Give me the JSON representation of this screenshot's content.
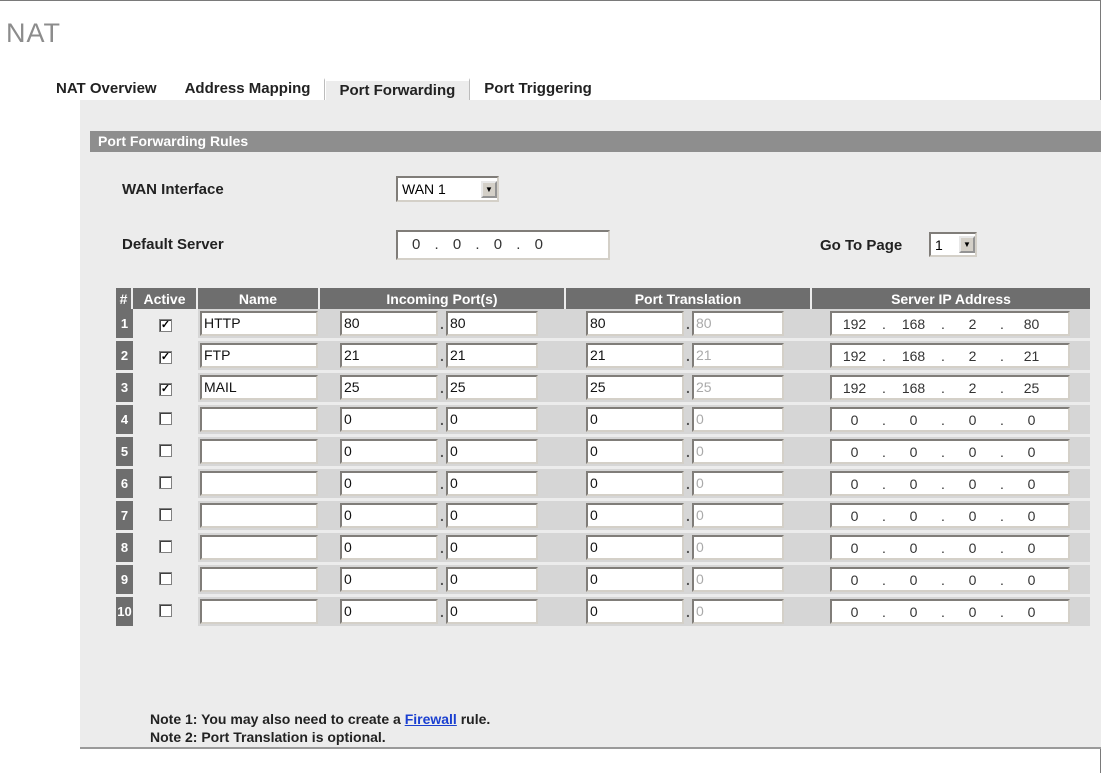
{
  "page_title": "NAT",
  "tabs": [
    {
      "label": "NAT Overview",
      "active": false
    },
    {
      "label": "Address Mapping",
      "active": false
    },
    {
      "label": "Port Forwarding",
      "active": true
    },
    {
      "label": "Port Triggering",
      "active": false
    }
  ],
  "section_title": "Port Forwarding Rules",
  "wan_interface": {
    "label": "WAN Interface",
    "value": "WAN 1"
  },
  "default_server": {
    "label": "Default Server",
    "octets": [
      "0",
      "0",
      "0",
      "0"
    ]
  },
  "go_to_page": {
    "label": "Go To Page",
    "value": "1"
  },
  "columns": [
    "#",
    "Active",
    "Name",
    "Incoming Port(s)",
    "Port Translation",
    "Server IP Address"
  ],
  "rows": [
    {
      "num": "1",
      "active": true,
      "name": "HTTP",
      "in_start": "80",
      "in_end": "80",
      "tr_start": "80",
      "tr_end": "80",
      "ip": [
        "192",
        "168",
        "2",
        "80"
      ]
    },
    {
      "num": "2",
      "active": true,
      "name": "FTP",
      "in_start": "21",
      "in_end": "21",
      "tr_start": "21",
      "tr_end": "21",
      "ip": [
        "192",
        "168",
        "2",
        "21"
      ]
    },
    {
      "num": "3",
      "active": true,
      "name": "MAIL",
      "in_start": "25",
      "in_end": "25",
      "tr_start": "25",
      "tr_end": "25",
      "ip": [
        "192",
        "168",
        "2",
        "25"
      ]
    },
    {
      "num": "4",
      "active": false,
      "name": "",
      "in_start": "0",
      "in_end": "0",
      "tr_start": "0",
      "tr_end": "0",
      "ip": [
        "0",
        "0",
        "0",
        "0"
      ]
    },
    {
      "num": "5",
      "active": false,
      "name": "",
      "in_start": "0",
      "in_end": "0",
      "tr_start": "0",
      "tr_end": "0",
      "ip": [
        "0",
        "0",
        "0",
        "0"
      ]
    },
    {
      "num": "6",
      "active": false,
      "name": "",
      "in_start": "0",
      "in_end": "0",
      "tr_start": "0",
      "tr_end": "0",
      "ip": [
        "0",
        "0",
        "0",
        "0"
      ]
    },
    {
      "num": "7",
      "active": false,
      "name": "",
      "in_start": "0",
      "in_end": "0",
      "tr_start": "0",
      "tr_end": "0",
      "ip": [
        "0",
        "0",
        "0",
        "0"
      ]
    },
    {
      "num": "8",
      "active": false,
      "name": "",
      "in_start": "0",
      "in_end": "0",
      "tr_start": "0",
      "tr_end": "0",
      "ip": [
        "0",
        "0",
        "0",
        "0"
      ]
    },
    {
      "num": "9",
      "active": false,
      "name": "",
      "in_start": "0",
      "in_end": "0",
      "tr_start": "0",
      "tr_end": "0",
      "ip": [
        "0",
        "0",
        "0",
        "0"
      ]
    },
    {
      "num": "10",
      "active": false,
      "name": "",
      "in_start": "0",
      "in_end": "0",
      "tr_start": "0",
      "tr_end": "0",
      "ip": [
        "0",
        "0",
        "0",
        "0"
      ]
    }
  ],
  "notes": {
    "note1_prefix": "Note 1: You may also need to create a ",
    "note1_link": "Firewall",
    "note1_suffix": " rule.",
    "note2": "Note 2: Port Translation is optional."
  },
  "ip_separator": ".",
  "check_glyph": "✓"
}
